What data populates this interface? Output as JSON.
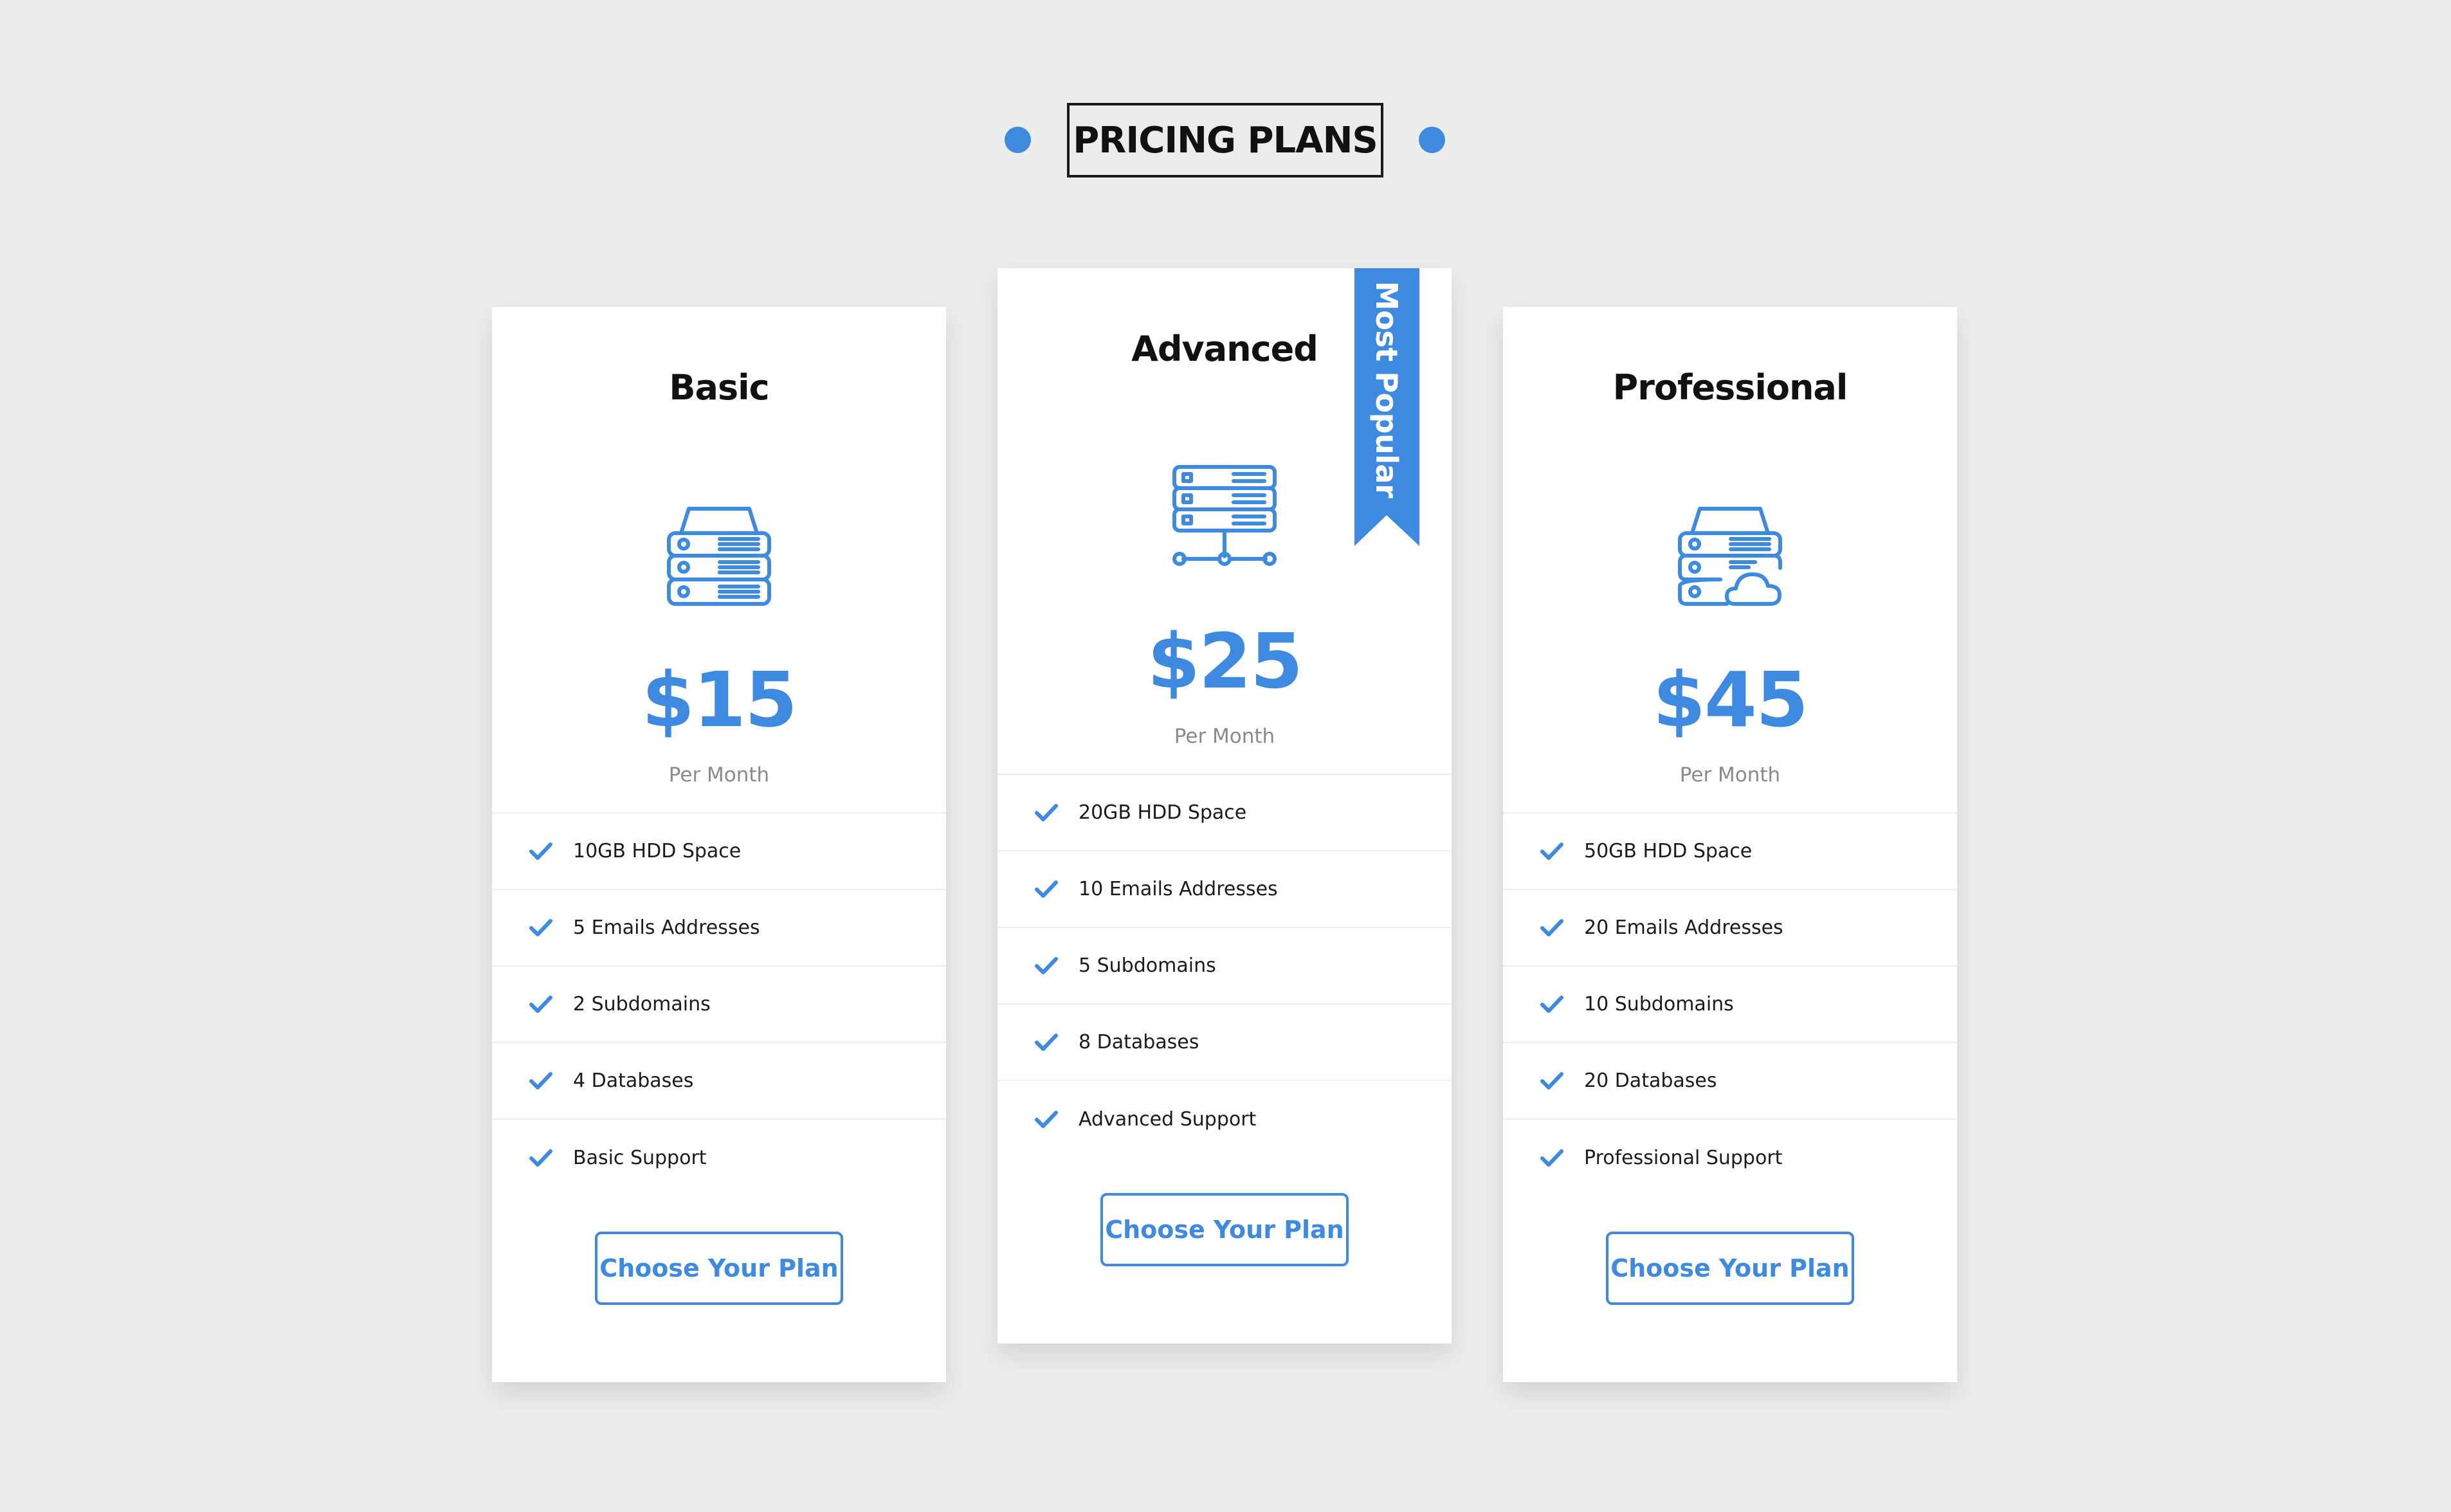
{
  "header": {
    "title": "PRICING PLANS"
  },
  "colors": {
    "accent": "#3d8ae0",
    "background": "#ececec",
    "card": "#ffffff"
  },
  "plans": [
    {
      "name": "Basic",
      "icon": "server-stack-icon",
      "price": "$15",
      "period": "Per Month",
      "features": [
        "10GB HDD Space",
        "5 Emails Addresses",
        "2 Subdomains",
        "4 Databases",
        "Basic Support"
      ],
      "cta": "Choose Your Plan"
    },
    {
      "name": "Advanced",
      "icon": "server-network-icon",
      "price": "$25",
      "period": "Per Month",
      "badge": "Most Popular",
      "features": [
        "20GB HDD Space",
        "10 Emails Addresses",
        "5 Subdomains",
        "8 Databases",
        "Advanced Support"
      ],
      "cta": "Choose Your Plan"
    },
    {
      "name": "Professional",
      "icon": "server-cloud-icon",
      "price": "$45",
      "period": "Per Month",
      "features": [
        "50GB HDD Space",
        "20 Emails Addresses",
        "10 Subdomains",
        "20 Databases",
        "Professional Support"
      ],
      "cta": "Choose Your Plan"
    }
  ]
}
